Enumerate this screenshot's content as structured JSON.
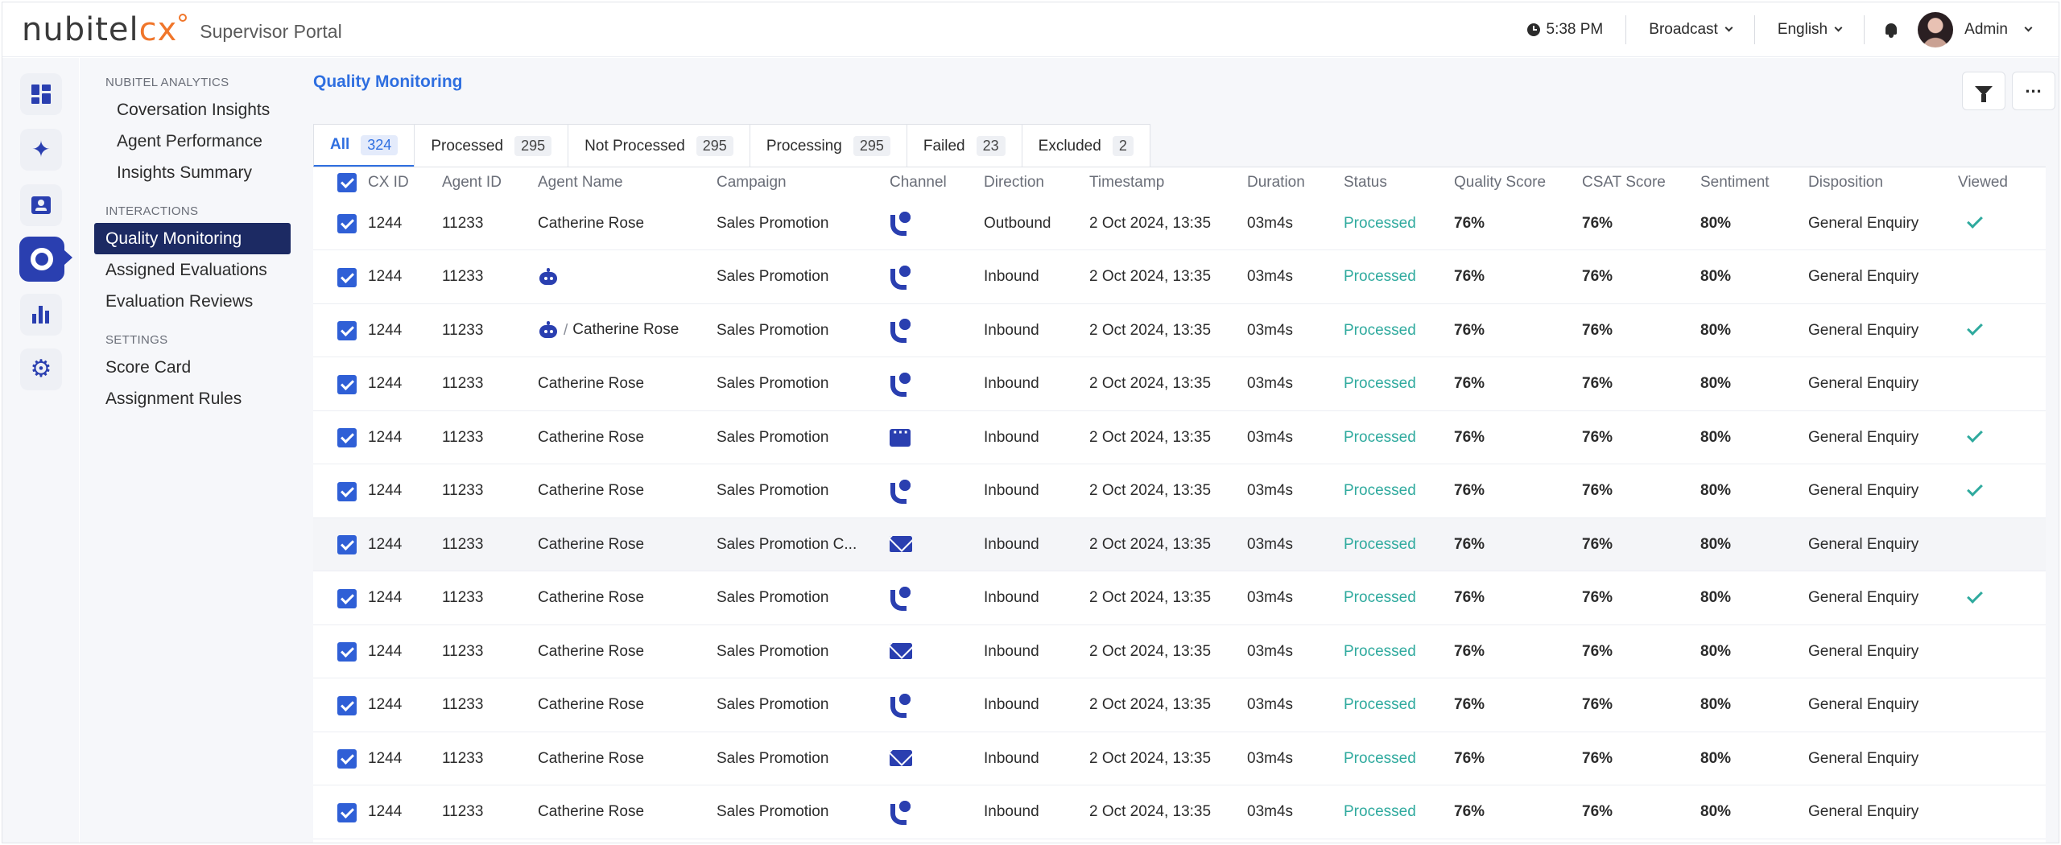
{
  "header": {
    "logo_main": "nubitel",
    "logo_accent": "cx",
    "portal_title": "Supervisor Portal",
    "time": "5:38 PM",
    "broadcast": "Broadcast",
    "language": "English",
    "user": "Admin"
  },
  "rail": {
    "icons": [
      "dashboard-icon",
      "sparkle-icon",
      "contact-card-icon",
      "quality-ring-icon",
      "bar-chart-icon",
      "gear-icon"
    ],
    "active_index": 3
  },
  "sidenav": {
    "sections": [
      {
        "title": "NUBITEL ANALYTICS",
        "items": [
          "Coversation Insights",
          "Agent Performance",
          "Insights Summary"
        ]
      },
      {
        "title": "INTERACTIONS",
        "items": [
          "Quality Monitoring",
          "Assigned Evaluations",
          "Evaluation Reviews"
        ]
      },
      {
        "title": "SETTINGS",
        "items": [
          "Score Card",
          "Assignment Rules"
        ]
      }
    ],
    "active_item": "Quality Monitoring"
  },
  "main": {
    "page_title": "Quality Monitoring",
    "tabs": [
      {
        "label": "All",
        "count": "324"
      },
      {
        "label": "Processed",
        "count": "295"
      },
      {
        "label": "Not Processed",
        "count": "295"
      },
      {
        "label": "Processing",
        "count": "295"
      },
      {
        "label": "Failed",
        "count": "23"
      },
      {
        "label": "Excluded",
        "count": "2"
      }
    ],
    "active_tab": "All"
  },
  "table": {
    "columns": [
      "CX ID",
      "Agent ID",
      "Agent Name",
      "Campaign",
      "Channel",
      "Direction",
      "Timestamp",
      "Duration",
      "Status",
      "Quality Score",
      "CSAT Score",
      "Sentiment",
      "Disposition",
      "Viewed"
    ],
    "rows": [
      {
        "cx_id": "1244",
        "agent_id": "11233",
        "agent_type": "human",
        "agent_name": "Catherine Rose",
        "campaign": "Sales Promotion",
        "channel": "phone-icon",
        "direction": "Outbound",
        "timestamp": "2 Oct 2024, 13:35",
        "duration": "03m4s",
        "status": "Processed",
        "quality": "76%",
        "csat": "76%",
        "sentiment": "80%",
        "disposition": "General Enquiry",
        "viewed": true
      },
      {
        "cx_id": "1244",
        "agent_id": "11233",
        "agent_type": "bot",
        "agent_name": "",
        "campaign": "Sales Promotion",
        "channel": "phone-icon",
        "direction": "Inbound",
        "timestamp": "2 Oct 2024, 13:35",
        "duration": "03m4s",
        "status": "Processed",
        "quality": "76%",
        "csat": "76%",
        "sentiment": "80%",
        "disposition": "General Enquiry",
        "viewed": false
      },
      {
        "cx_id": "1244",
        "agent_id": "11233",
        "agent_type": "bot-human",
        "agent_name": "Catherine Rose",
        "campaign": "Sales Promotion",
        "channel": "phone-icon",
        "direction": "Inbound",
        "timestamp": "2 Oct 2024, 13:35",
        "duration": "03m4s",
        "status": "Processed",
        "quality": "76%",
        "csat": "76%",
        "sentiment": "80%",
        "disposition": "General Enquiry",
        "viewed": true
      },
      {
        "cx_id": "1244",
        "agent_id": "11233",
        "agent_type": "human",
        "agent_name": "Catherine Rose",
        "campaign": "Sales Promotion",
        "channel": "phone-icon",
        "direction": "Inbound",
        "timestamp": "2 Oct 2024, 13:35",
        "duration": "03m4s",
        "status": "Processed",
        "quality": "76%",
        "csat": "76%",
        "sentiment": "80%",
        "disposition": "General Enquiry",
        "viewed": false
      },
      {
        "cx_id": "1244",
        "agent_id": "11233",
        "agent_type": "human",
        "agent_name": "Catherine Rose",
        "campaign": "Sales Promotion",
        "channel": "chat-icon",
        "direction": "Inbound",
        "timestamp": "2 Oct 2024, 13:35",
        "duration": "03m4s",
        "status": "Processed",
        "quality": "76%",
        "csat": "76%",
        "sentiment": "80%",
        "disposition": "General Enquiry",
        "viewed": true
      },
      {
        "cx_id": "1244",
        "agent_id": "11233",
        "agent_type": "human",
        "agent_name": "Catherine Rose",
        "campaign": "Sales Promotion",
        "channel": "phone-icon",
        "direction": "Inbound",
        "timestamp": "2 Oct 2024, 13:35",
        "duration": "03m4s",
        "status": "Processed",
        "quality": "76%",
        "csat": "76%",
        "sentiment": "80%",
        "disposition": "General Enquiry",
        "viewed": true
      },
      {
        "cx_id": "1244",
        "agent_id": "11233",
        "agent_type": "human",
        "agent_name": "Catherine Rose",
        "campaign": "Sales Promotion C...",
        "channel": "mail-icon",
        "direction": "Inbound",
        "timestamp": "2 Oct 2024, 13:35",
        "duration": "03m4s",
        "status": "Processed",
        "quality": "76%",
        "csat": "76%",
        "sentiment": "80%",
        "disposition": "General Enquiry",
        "viewed": false,
        "highlighted": true
      },
      {
        "cx_id": "1244",
        "agent_id": "11233",
        "agent_type": "human",
        "agent_name": "Catherine Rose",
        "campaign": "Sales Promotion",
        "channel": "phone-icon",
        "direction": "Inbound",
        "timestamp": "2 Oct 2024, 13:35",
        "duration": "03m4s",
        "status": "Processed",
        "quality": "76%",
        "csat": "76%",
        "sentiment": "80%",
        "disposition": "General Enquiry",
        "viewed": true
      },
      {
        "cx_id": "1244",
        "agent_id": "11233",
        "agent_type": "human",
        "agent_name": "Catherine Rose",
        "campaign": "Sales Promotion",
        "channel": "mail-icon",
        "direction": "Inbound",
        "timestamp": "2 Oct 2024, 13:35",
        "duration": "03m4s",
        "status": "Processed",
        "quality": "76%",
        "csat": "76%",
        "sentiment": "80%",
        "disposition": "General Enquiry",
        "viewed": false
      },
      {
        "cx_id": "1244",
        "agent_id": "11233",
        "agent_type": "human",
        "agent_name": "Catherine Rose",
        "campaign": "Sales Promotion",
        "channel": "phone-icon",
        "direction": "Inbound",
        "timestamp": "2 Oct 2024, 13:35",
        "duration": "03m4s",
        "status": "Processed",
        "quality": "76%",
        "csat": "76%",
        "sentiment": "80%",
        "disposition": "General Enquiry",
        "viewed": false
      },
      {
        "cx_id": "1244",
        "agent_id": "11233",
        "agent_type": "human",
        "agent_name": "Catherine Rose",
        "campaign": "Sales Promotion",
        "channel": "mail-icon",
        "direction": "Inbound",
        "timestamp": "2 Oct 2024, 13:35",
        "duration": "03m4s",
        "status": "Processed",
        "quality": "76%",
        "csat": "76%",
        "sentiment": "80%",
        "disposition": "General Enquiry",
        "viewed": false
      },
      {
        "cx_id": "1244",
        "agent_id": "11233",
        "agent_type": "human",
        "agent_name": "Catherine Rose",
        "campaign": "Sales Promotion",
        "channel": "phone-icon",
        "direction": "Inbound",
        "timestamp": "2 Oct 2024, 13:35",
        "duration": "03m4s",
        "status": "Processed",
        "quality": "76%",
        "csat": "76%",
        "sentiment": "80%",
        "disposition": "General Enquiry",
        "viewed": false
      }
    ]
  },
  "colors": {
    "accent": "#2f6fe0",
    "brand_navy": "#1c2a63",
    "icon_blue": "#2a3fb0",
    "status_green": "#2faa9e",
    "logo_orange": "#f0762b"
  }
}
